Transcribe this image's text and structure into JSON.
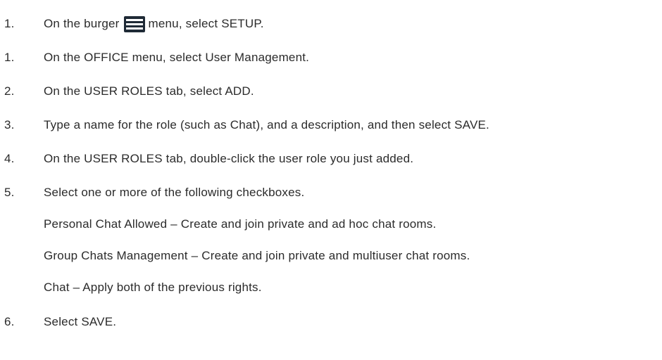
{
  "steps": [
    {
      "num": "1.",
      "before": "On the burger",
      "after": "menu, select SETUP.",
      "icon": "burger-menu-icon"
    },
    {
      "num": "1.",
      "text": "On the OFFICE menu, select User Management."
    },
    {
      "num": "2.",
      "text": "On the USER ROLES tab, select ADD."
    },
    {
      "num": "3.",
      "text": "Type a name for the role (such as Chat), and a description, and then select SAVE."
    },
    {
      "num": "4.",
      "text": "On the USER ROLES tab, double-click the user role you just added."
    },
    {
      "num": "5.",
      "text": "Select one or more of the following checkboxes."
    },
    {
      "num": "6.",
      "text": "Select SAVE."
    }
  ],
  "checkbox_options": [
    "Personal Chat Allowed – Create and join private and ad hoc chat rooms.",
    "Group Chats Management – Create and join private and multiuser chat rooms.",
    "Chat – Apply both of the previous rights."
  ]
}
